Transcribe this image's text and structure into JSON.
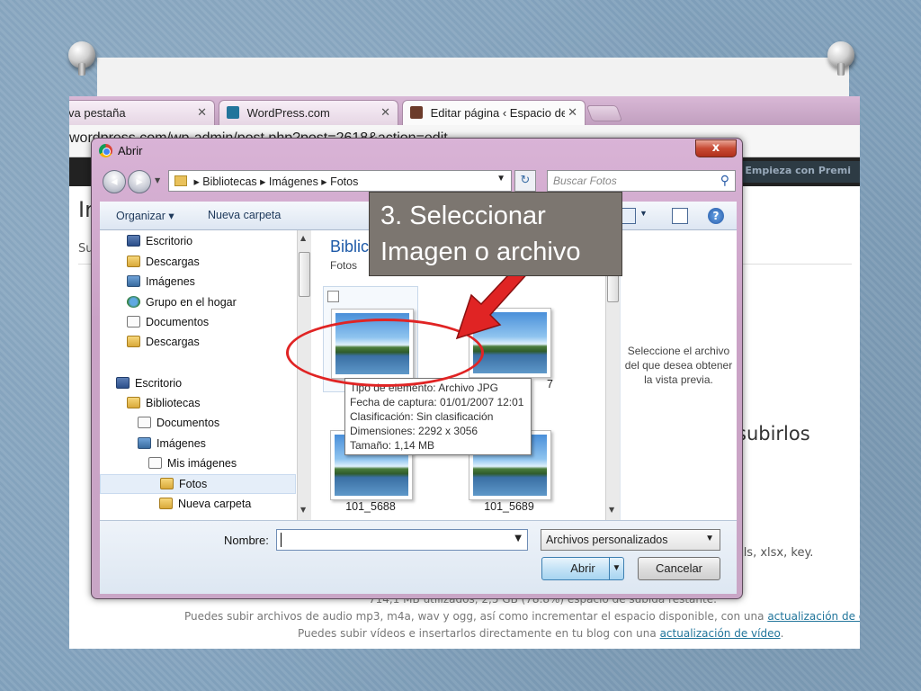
{
  "browser": {
    "tabs": [
      {
        "label": "va pestaña"
      },
      {
        "label": "WordPress.com"
      },
      {
        "label": "Editar página ‹ Espacio de"
      }
    ],
    "url": "wordpress.com/wp-admin/post.php?post=2618&action=edit",
    "cta": "Empieza con Premi"
  },
  "wp": {
    "heading": "In",
    "sub": "Su",
    "subirlos": "subirlos",
    "extensions": "xls, xlsx, key.",
    "footer_line1": "714,1 MB utilizados, 2,5 GB (78.8%) espacio de subida restante.",
    "footer_line2_text": "Puedes subir archivos de audio mp3, m4a, wav y ogg, así como incrementar el espacio disponible, con una",
    "footer_line2_link": "actualización de es",
    "footer_line3_text": "Puedes subir vídeos e insertarlos directamente en tu blog con una",
    "footer_line3_link": "actualización de vídeo",
    "footer_line3_end": "."
  },
  "dialog": {
    "title": "Abrir",
    "close": "x",
    "breadcrumb": [
      "Bibliotecas",
      "Imágenes",
      "Fotos"
    ],
    "search_placeholder": "Buscar Fotos",
    "toolbar": {
      "organize": "Organizar ▾",
      "new_folder": "Nueva carpeta"
    },
    "nav": [
      {
        "label": "Escritorio",
        "icon": "desk"
      },
      {
        "label": "Descargas",
        "icon": "fold"
      },
      {
        "label": "Imágenes",
        "icon": "img"
      },
      {
        "label": "Grupo en el hogar",
        "icon": "grp"
      },
      {
        "label": "Documentos",
        "icon": "doc"
      },
      {
        "label": "Descargas",
        "icon": "fold"
      },
      {
        "label": "Escritorio",
        "icon": "desk"
      },
      {
        "label": "Bibliotecas",
        "icon": "fold"
      },
      {
        "label": "Documentos",
        "icon": "doc"
      },
      {
        "label": "Imágenes",
        "icon": "img"
      },
      {
        "label": "Mis imágenes",
        "icon": "doc"
      },
      {
        "label": "Fotos",
        "icon": "fold"
      },
      {
        "label": "Nueva carpeta",
        "icon": "fold"
      }
    ],
    "library_title": "Biblic",
    "library_sub": "Fotos",
    "files": [
      {
        "caption": ""
      },
      {
        "caption": "7"
      },
      {
        "caption": "101_5688"
      },
      {
        "caption": "101_5689"
      }
    ],
    "tooltip": [
      "Tipo de elemento: Archivo JPG",
      "Fecha de captura: 01/01/2007 12:01",
      "Clasificación: Sin clasificación",
      "Dimensiones: 2292 x 3056",
      "Tamaño: 1,14 MB"
    ],
    "preview_text": "Seleccione el archivo del que desea obtener la vista previa.",
    "name_label": "Nombre:",
    "name_value": "",
    "filter": "Archivos personalizados",
    "open": "Abrir",
    "cancel": "Cancelar"
  },
  "annotation": {
    "callout": "3. Seleccionar Imagen o archivo"
  },
  "colors": {
    "highlight": "#e02424",
    "callout_bg": "#7c7670"
  }
}
